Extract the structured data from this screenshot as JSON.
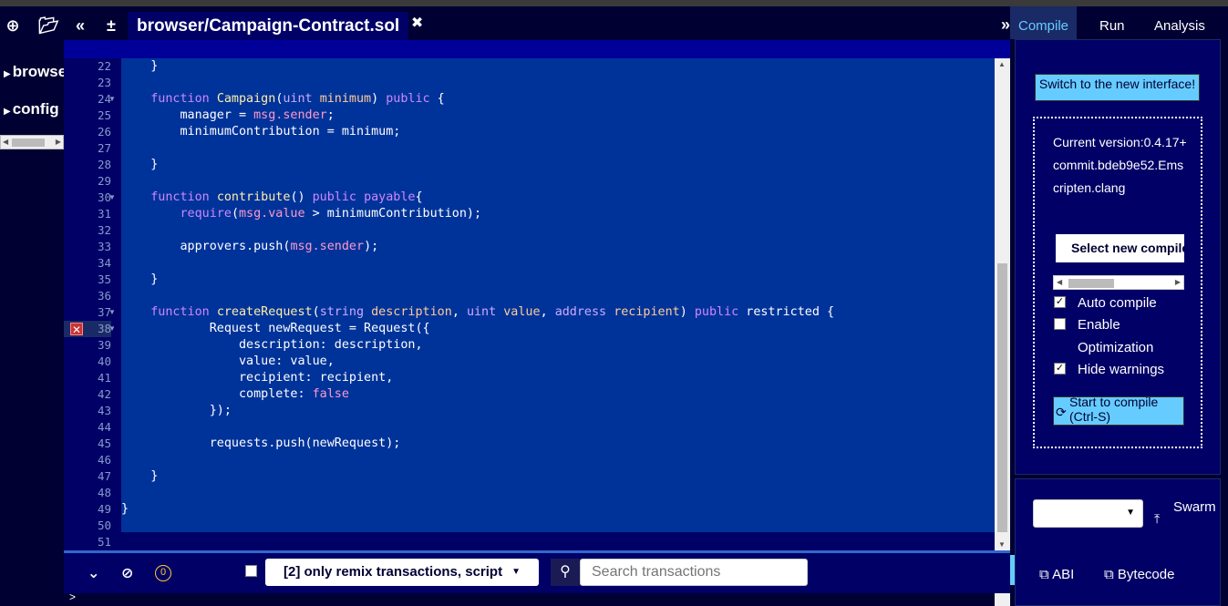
{
  "left_panel": {
    "icons": [
      "plus-icon",
      "folder-open-icon",
      "collapse-left-icon",
      "plus-minus-icon"
    ],
    "tree": [
      {
        "label": "browser"
      },
      {
        "label": "config"
      }
    ]
  },
  "tabs": {
    "active_title": "browser/Campaign-Contract.sol",
    "close_glyph": "✖"
  },
  "editor": {
    "error_line": 38,
    "lines": [
      {
        "n": "22",
        "code": "    }"
      },
      {
        "n": "23",
        "code": ""
      },
      {
        "n": "24",
        "code": "    function Campaign(uint minimum) public {",
        "fold": true
      },
      {
        "n": "25",
        "code": "        manager = msg.sender;"
      },
      {
        "n": "26",
        "code": "        minimumContribution = minimum;"
      },
      {
        "n": "27",
        "code": ""
      },
      {
        "n": "28",
        "code": "    }"
      },
      {
        "n": "29",
        "code": ""
      },
      {
        "n": "30",
        "code": "    function contribute() public payable{",
        "fold": true
      },
      {
        "n": "31",
        "code": "        require(msg.value > minimumContribution);"
      },
      {
        "n": "32",
        "code": ""
      },
      {
        "n": "33",
        "code": "        approvers.push(msg.sender);"
      },
      {
        "n": "34",
        "code": ""
      },
      {
        "n": "35",
        "code": "    }"
      },
      {
        "n": "36",
        "code": ""
      },
      {
        "n": "37",
        "code": "    function createRequest(string description, uint value, address recipient) public restricted {",
        "fold": true
      },
      {
        "n": "38",
        "code": "            Request newRequest = Request({",
        "fold": true
      },
      {
        "n": "39",
        "code": "                description: description,"
      },
      {
        "n": "40",
        "code": "                value: value,"
      },
      {
        "n": "41",
        "code": "                recipient: recipient,"
      },
      {
        "n": "42",
        "code": "                complete: false"
      },
      {
        "n": "43",
        "code": "            });"
      },
      {
        "n": "44",
        "code": ""
      },
      {
        "n": "45",
        "code": "            requests.push(newRequest);"
      },
      {
        "n": "46",
        "code": ""
      },
      {
        "n": "47",
        "code": "    }"
      },
      {
        "n": "48",
        "code": ""
      },
      {
        "n": "49",
        "code": "}"
      },
      {
        "n": "50",
        "code": ""
      },
      {
        "n": "51",
        "code": ""
      }
    ]
  },
  "terminal": {
    "pending_count": "0",
    "filter_label": "[2] only remix transactions, script",
    "search_placeholder": "Search transactions",
    "prompt": ">"
  },
  "right_panel": {
    "tabs": [
      "Compile",
      "Run",
      "Analysis"
    ],
    "switch_button": "Switch to the new interface!",
    "current_version": "Current version:0.4.17+commit.bdeb9e52.Emscripten.clang",
    "select_compiler": "Select new compiler version",
    "options": {
      "auto_compile": "Auto compile",
      "enable_optimization": "Enable Optimization",
      "hide_warnings": "Hide warnings"
    },
    "compile_button": "Start to compile (Ctrl-S)",
    "swarm_label": "Swarm",
    "abi_label": "ABI",
    "bytecode_label": "Bytecode"
  },
  "colors": {
    "editor_bg": "#003399",
    "accent": "#66ccff",
    "panel_bg": "#000066"
  }
}
